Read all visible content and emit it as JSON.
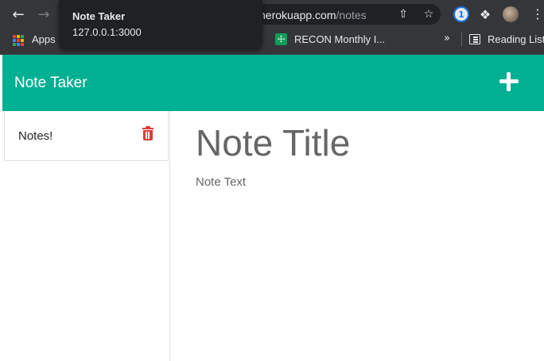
{
  "browser": {
    "url_host": "herokuapp.com",
    "url_path": "/notes",
    "url_prefix": "",
    "tooltip": {
      "title": "Note Taker",
      "url": "127.0.0.1:3000"
    },
    "bookmarks": [
      {
        "label": "Apps",
        "icon": "apps-grid-icon"
      },
      {
        "label": "RECON Monthly I...",
        "icon": "google-sheets-icon"
      }
    ],
    "more_bookmarks": "»",
    "reading_list": "Reading List",
    "icons": [
      "back-arrow-icon",
      "forward-arrow-icon",
      "share-icon",
      "star-icon",
      "onepassword-icon",
      "extensions-puzzle-icon",
      "profile-avatar",
      "kebab-menu-icon"
    ]
  },
  "app": {
    "brand": "Note Taker",
    "add_icon": "plus-icon",
    "accent_color": "#00b092",
    "delete_color": "#e53935",
    "notes": [
      {
        "title": "Notes!"
      }
    ],
    "editor": {
      "title_placeholder": "Note Title",
      "text_placeholder": "Note Text"
    }
  }
}
